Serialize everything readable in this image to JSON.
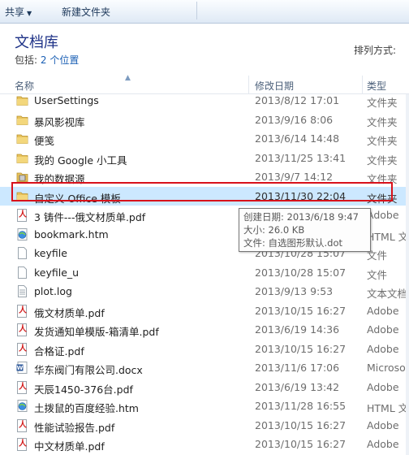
{
  "toolbar": {
    "share_label": "共享",
    "new_folder_label": "新建文件夹"
  },
  "library": {
    "title": "文档库",
    "includes_label": "包括:",
    "locations_link": "2 个位置",
    "arrange_label": "排列方式:"
  },
  "columns": {
    "name": "名称",
    "date": "修改日期",
    "type": "类型"
  },
  "files": [
    {
      "name": "UserSettings",
      "date": "2013/8/12 17:01",
      "type": "文件夹",
      "icon": "folder-icon"
    },
    {
      "name": "暴风影视库",
      "date": "2013/9/16 8:06",
      "type": "文件夹",
      "icon": "folder-icon"
    },
    {
      "name": "便笺",
      "date": "2013/6/14 14:48",
      "type": "文件夹",
      "icon": "folder-icon"
    },
    {
      "name": "我的 Google 小工具",
      "date": "2013/11/25 13:41",
      "type": "文件夹",
      "icon": "folder-icon"
    },
    {
      "name": "我的数据源",
      "date": "2013/9/7 14:12",
      "type": "文件夹",
      "icon": "data-source-folder-icon"
    },
    {
      "name": "自定义 Office 模板",
      "date": "2013/11/30 22:04",
      "type": "文件夹",
      "icon": "folder-icon",
      "selected": true
    },
    {
      "name": "3 铸件---俄文材质单.pdf",
      "date": "",
      "type": "Adobe",
      "icon": "pdf-file-icon"
    },
    {
      "name": "bookmark.htm",
      "date": "",
      "type": "HTML 文",
      "icon": "html-file-icon"
    },
    {
      "name": "keyfile",
      "date": "2013/10/28 15:07",
      "type": "文件",
      "icon": "blank-file-icon"
    },
    {
      "name": "keyfile_u",
      "date": "2013/10/28 15:07",
      "type": "文件",
      "icon": "blank-file-icon"
    },
    {
      "name": "plot.log",
      "date": "2013/9/13 9:53",
      "type": "文本文档",
      "icon": "text-file-icon"
    },
    {
      "name": "俄文材质单.pdf",
      "date": "2013/10/15 16:27",
      "type": "Adobe",
      "icon": "pdf-file-icon"
    },
    {
      "name": "发货通知单模版-箱清单.pdf",
      "date": "2013/6/19 14:36",
      "type": "Adobe",
      "icon": "pdf-file-icon"
    },
    {
      "name": "合格证.pdf",
      "date": "2013/10/15 16:27",
      "type": "Adobe",
      "icon": "pdf-file-icon"
    },
    {
      "name": "华东阀门有限公司.docx",
      "date": "2013/11/6 17:06",
      "type": "Microso",
      "icon": "word-file-icon"
    },
    {
      "name": "天辰1450-376台.pdf",
      "date": "2013/6/19 13:42",
      "type": "Adobe",
      "icon": "pdf-file-icon"
    },
    {
      "name": "土拨鼠的百度经验.htm",
      "date": "2013/11/28 16:55",
      "type": "HTML 文",
      "icon": "html-file-icon"
    },
    {
      "name": "性能试验报告.pdf",
      "date": "2013/10/15 16:27",
      "type": "Adobe",
      "icon": "pdf-file-icon"
    },
    {
      "name": "中文材质单.pdf",
      "date": "2013/10/15 16:27",
      "type": "Adobe",
      "icon": "pdf-file-icon"
    }
  ],
  "tooltip": {
    "created": "创建日期: 2013/6/18 9:47",
    "size": "大小: 26.0 KB",
    "files": "文件: 自选图形默认.dot"
  },
  "colors": {
    "selection": "#cce8ff",
    "highlight_border": "#d8121b",
    "title": "#1e3287",
    "link": "#1a5fb4"
  }
}
